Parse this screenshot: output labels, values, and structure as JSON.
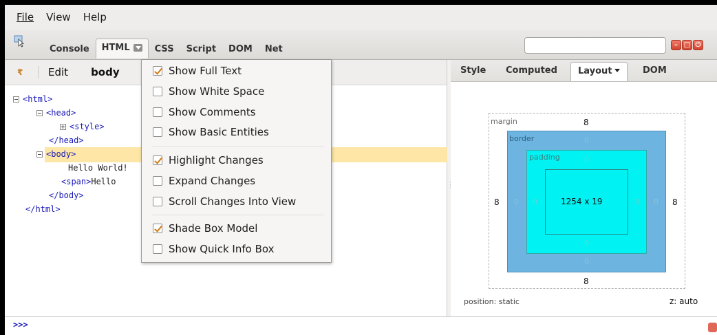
{
  "menubar": {
    "file": "File",
    "view": "View",
    "help": "Help"
  },
  "toolbar": {
    "tabs": [
      "Console",
      "HTML",
      "CSS",
      "Script",
      "DOM",
      "Net"
    ],
    "active_tab": "HTML",
    "search_value": ""
  },
  "left": {
    "edit_label": "Edit",
    "breadcrumb": "body",
    "tree": {
      "html_open": "<html>",
      "head_open": "<head>",
      "style": "<style>",
      "head_close": "</head>",
      "body_open": "<body>",
      "text": "Hello World!",
      "span_open": "<span>",
      "span_text": "Hello",
      "body_close": "</body>",
      "html_close": "</html>"
    }
  },
  "popup_menu": {
    "items": [
      {
        "label": "Show Full Text",
        "checked": true
      },
      {
        "label": "Show White Space",
        "checked": false
      },
      {
        "label": "Show Comments",
        "checked": false
      },
      {
        "label": "Show Basic Entities",
        "checked": false
      },
      {
        "label": "Highlight Changes",
        "checked": true
      },
      {
        "label": "Expand Changes",
        "checked": false
      },
      {
        "label": "Scroll Changes Into View",
        "checked": false
      },
      {
        "label": "Shade Box Model",
        "checked": true
      },
      {
        "label": "Show Quick Info Box",
        "checked": false
      }
    ]
  },
  "right": {
    "tabs": [
      "Style",
      "Computed",
      "Layout",
      "DOM"
    ],
    "active_tab": "Layout",
    "box_model": {
      "margin_label": "margin",
      "margin_top": "8",
      "margin_bottom": "8",
      "margin_left": "8",
      "margin_right": "8",
      "border_label": "border",
      "border_top": "0",
      "border_bottom": "0",
      "border_left": "0",
      "border_right": "0",
      "padding_label": "padding",
      "padding_top": "0",
      "padding_bottom": "0",
      "padding_left": "0",
      "padding_right": "0",
      "content_size": "1254 x 19"
    },
    "position": "position: static",
    "z_index": "z: auto"
  },
  "command_line": {
    "prompt": ">>>"
  },
  "colors": {
    "highlight_row": "#fde6a6",
    "border_box": "#6db5e0",
    "padding_box": "#00f2f2",
    "check": "#d27a10"
  }
}
